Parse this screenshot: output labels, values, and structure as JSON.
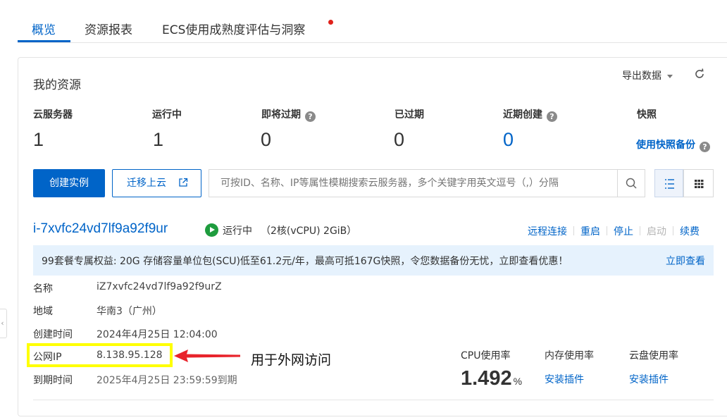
{
  "tabs": [
    {
      "label": "概览",
      "active": true
    },
    {
      "label": "资源报表",
      "active": false
    },
    {
      "label": "ECS使用成熟度评估与洞察",
      "active": false
    }
  ],
  "resources": {
    "title": "我的资源",
    "export_label": "导出数据",
    "stats": [
      {
        "label": "云服务器",
        "value": "1"
      },
      {
        "label": "运行中",
        "value": "1"
      },
      {
        "label": "即将过期",
        "value": "0"
      },
      {
        "label": "已过期",
        "value": "0"
      },
      {
        "label": "近期创建",
        "value": "0"
      },
      {
        "label": "快照",
        "link": "使用快照备份"
      }
    ]
  },
  "toolbar": {
    "create_label": "创建实例",
    "migrate_label": "迁移上云",
    "search_placeholder": "可按ID、名称、IP等属性模糊搜索云服务器，多个关键字用英文逗号（,）分隔"
  },
  "instance": {
    "id": "i-7xvfc24vd7lf9a92f9ur",
    "status": "运行中",
    "spec": "（2核(vCPU) 2GiB）",
    "actions": [
      "远程连接",
      "重启",
      "停止",
      "启动",
      "续费"
    ],
    "promo_text": "99套餐专属权益: 20G 存储容量单位包(SCU)低至61.2元/年，最高可抵167G快照，令您数据备份无忧，立即查看优惠！",
    "promo_link": "立即查看",
    "details": [
      {
        "label": "名称",
        "value": "iZ7xvfc24vd7lf9a92f9urZ"
      },
      {
        "label": "地域",
        "value": "华南3（广州）"
      },
      {
        "label": "创建时间",
        "value": "2024年4月25日 12:04:00"
      },
      {
        "label": "公网IP",
        "value": "8.138.95.128"
      },
      {
        "label": "到期时间",
        "value": "2025年4月25日 23:59:59到期"
      }
    ],
    "metrics": {
      "cpu_label": "CPU使用率",
      "cpu_value": "1.492",
      "cpu_unit": "%",
      "mem_label": "内存使用率",
      "mem_link": "安装插件",
      "disk_label": "云盘使用率",
      "disk_link": "安装插件"
    }
  },
  "annotation": "用于外网访问",
  "colors": {
    "primary": "#0064c8",
    "running": "#1e9c3e",
    "highlight": "#ffff00",
    "arrow": "#e8232b"
  }
}
